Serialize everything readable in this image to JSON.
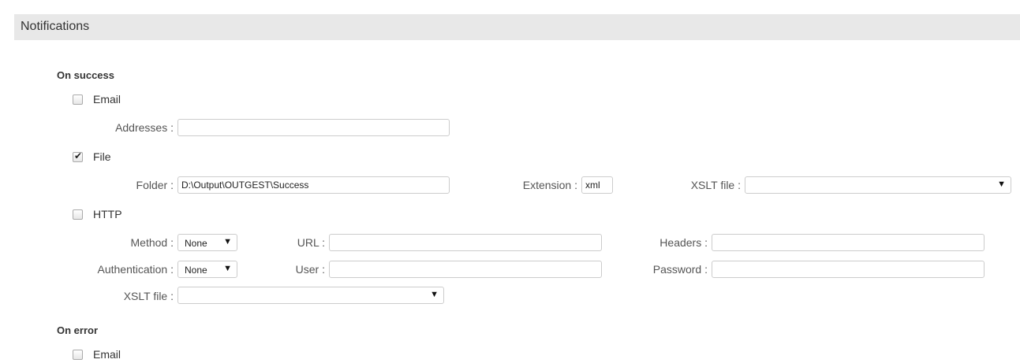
{
  "panel": {
    "title": "Notifications"
  },
  "on_success": {
    "title": "On success",
    "email": {
      "label": "Email",
      "checked": false,
      "addresses_label": "Addresses :",
      "addresses_value": ""
    },
    "file": {
      "label": "File",
      "checked": true,
      "folder_label": "Folder :",
      "folder_value": "D:\\Output\\OUTGEST\\Success",
      "extension_label": "Extension :",
      "extension_value": "xml",
      "xslt_label": "XSLT file :",
      "xslt_value": ""
    },
    "http": {
      "label": "HTTP",
      "checked": false,
      "method_label": "Method :",
      "method_value": "None",
      "url_label": "URL :",
      "url_value": "",
      "headers_label": "Headers :",
      "headers_value": "",
      "auth_label": "Authentication :",
      "auth_value": "None",
      "user_label": "User :",
      "user_value": "",
      "password_label": "Password :",
      "password_value": "",
      "xslt_label": "XSLT file :",
      "xslt_value": ""
    }
  },
  "on_error": {
    "title": "On error",
    "email": {
      "label": "Email",
      "checked": false
    }
  },
  "icons": {
    "checkmark": "✔",
    "dropdown": "▼"
  }
}
